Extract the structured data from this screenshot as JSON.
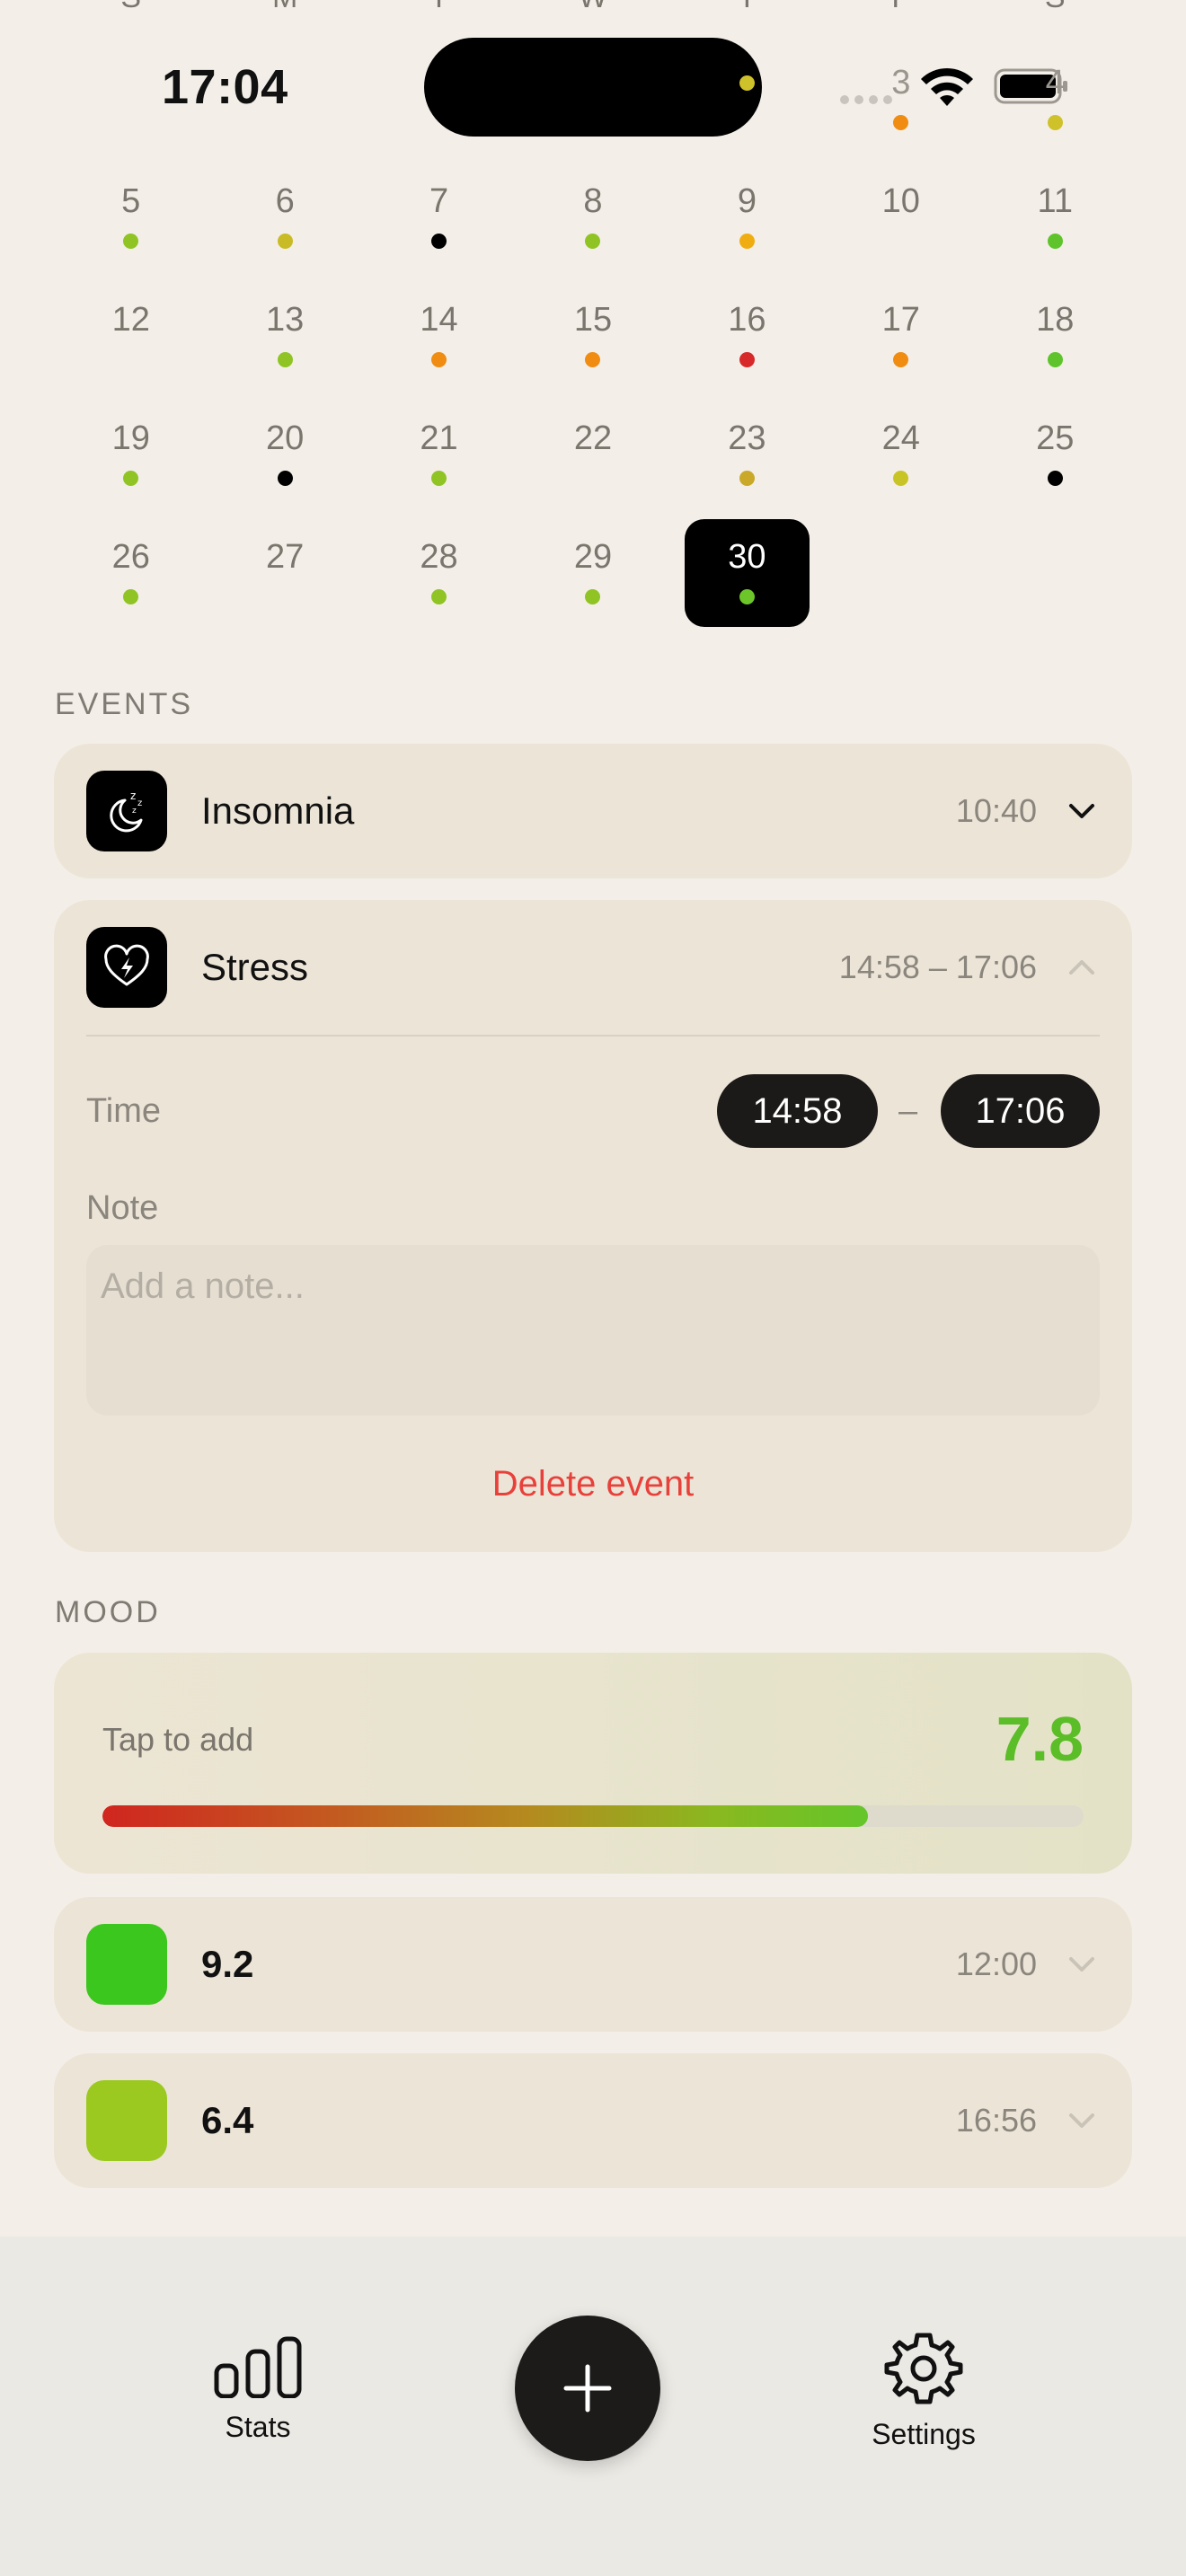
{
  "status_bar": {
    "time": "17:04"
  },
  "calendar": {
    "weekdays": [
      "S",
      "M",
      "T",
      "W",
      "T",
      "F",
      "S"
    ],
    "weeks": [
      [
        {
          "day": "",
          "dot": null
        },
        {
          "day": "",
          "dot": null
        },
        {
          "day": "",
          "dot": null
        },
        {
          "day": "",
          "dot": null
        },
        {
          "day": "",
          "dot": "#cfc12a"
        },
        {
          "day": "3",
          "dot": "#f08c12"
        },
        {
          "day": "4",
          "dot": "#cfc12a"
        }
      ],
      [
        {
          "day": "5",
          "dot": "#8fc424"
        },
        {
          "day": "6",
          "dot": "#c9bb25"
        },
        {
          "day": "7",
          "dot": "#000000"
        },
        {
          "day": "8",
          "dot": "#8fc424"
        },
        {
          "day": "9",
          "dot": "#f0ad12"
        },
        {
          "day": "10",
          "dot": null
        },
        {
          "day": "11",
          "dot": "#5fc42b"
        }
      ],
      [
        {
          "day": "12",
          "dot": null
        },
        {
          "day": "13",
          "dot": "#8fc424"
        },
        {
          "day": "14",
          "dot": "#f08c12"
        },
        {
          "day": "15",
          "dot": "#f08c12"
        },
        {
          "day": "16",
          "dot": "#d7282a"
        },
        {
          "day": "17",
          "dot": "#f08c12"
        },
        {
          "day": "18",
          "dot": "#5fc42b"
        }
      ],
      [
        {
          "day": "19",
          "dot": "#8fc424"
        },
        {
          "day": "20",
          "dot": "#000000"
        },
        {
          "day": "21",
          "dot": "#8fc424"
        },
        {
          "day": "22",
          "dot": null
        },
        {
          "day": "23",
          "dot": "#c9a82a"
        },
        {
          "day": "24",
          "dot": "#c9c425"
        },
        {
          "day": "25",
          "dot": "#000000"
        }
      ],
      [
        {
          "day": "26",
          "dot": "#8fc424"
        },
        {
          "day": "27",
          "dot": null
        },
        {
          "day": "28",
          "dot": "#8fc424"
        },
        {
          "day": "29",
          "dot": "#8fc424"
        },
        {
          "day": "30",
          "dot": "#6cc62a",
          "selected": true
        },
        {
          "day": "",
          "dot": null
        },
        {
          "day": "",
          "dot": null
        }
      ]
    ]
  },
  "events": {
    "section_title": "EVENTS",
    "items": [
      {
        "name": "Insomnia",
        "time": "10:40",
        "icon": "moon-sleep-icon",
        "expanded": false
      },
      {
        "name": "Stress",
        "time": "14:58 – 17:06",
        "icon": "heart-bolt-icon",
        "expanded": true,
        "time_label": "Time",
        "start": "14:58",
        "dash": "–",
        "end": "17:06",
        "note_label": "Note",
        "note_placeholder": "Add a note...",
        "delete_label": "Delete event"
      }
    ]
  },
  "mood": {
    "section_title": "MOOD",
    "tap_label": "Tap to add",
    "score": "7.8",
    "score_fraction": 0.78,
    "score_color": "#5bbd27",
    "entries": [
      {
        "value": "9.2",
        "time": "12:00",
        "color": "#3cc71f"
      },
      {
        "value": "6.4",
        "time": "16:56",
        "color": "#9bc920"
      }
    ]
  },
  "tabbar": {
    "stats_label": "Stats",
    "settings_label": "Settings",
    "add_icon": "plus-icon"
  }
}
